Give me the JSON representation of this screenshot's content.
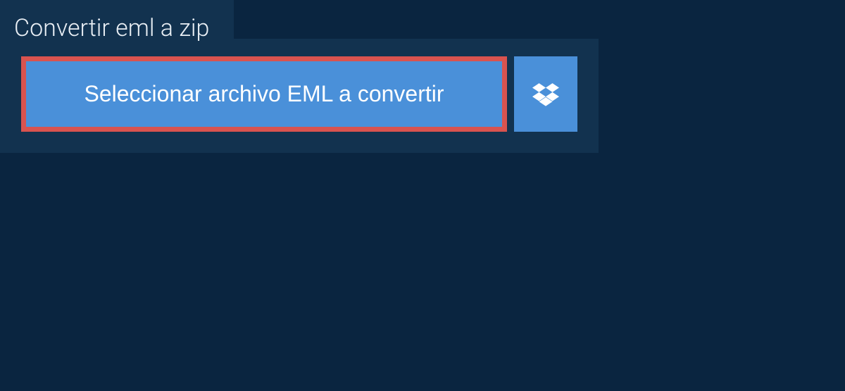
{
  "header": {
    "title": "Convertir eml a zip"
  },
  "actions": {
    "select_file_label": "Seleccionar archivo EML a convertir"
  }
}
